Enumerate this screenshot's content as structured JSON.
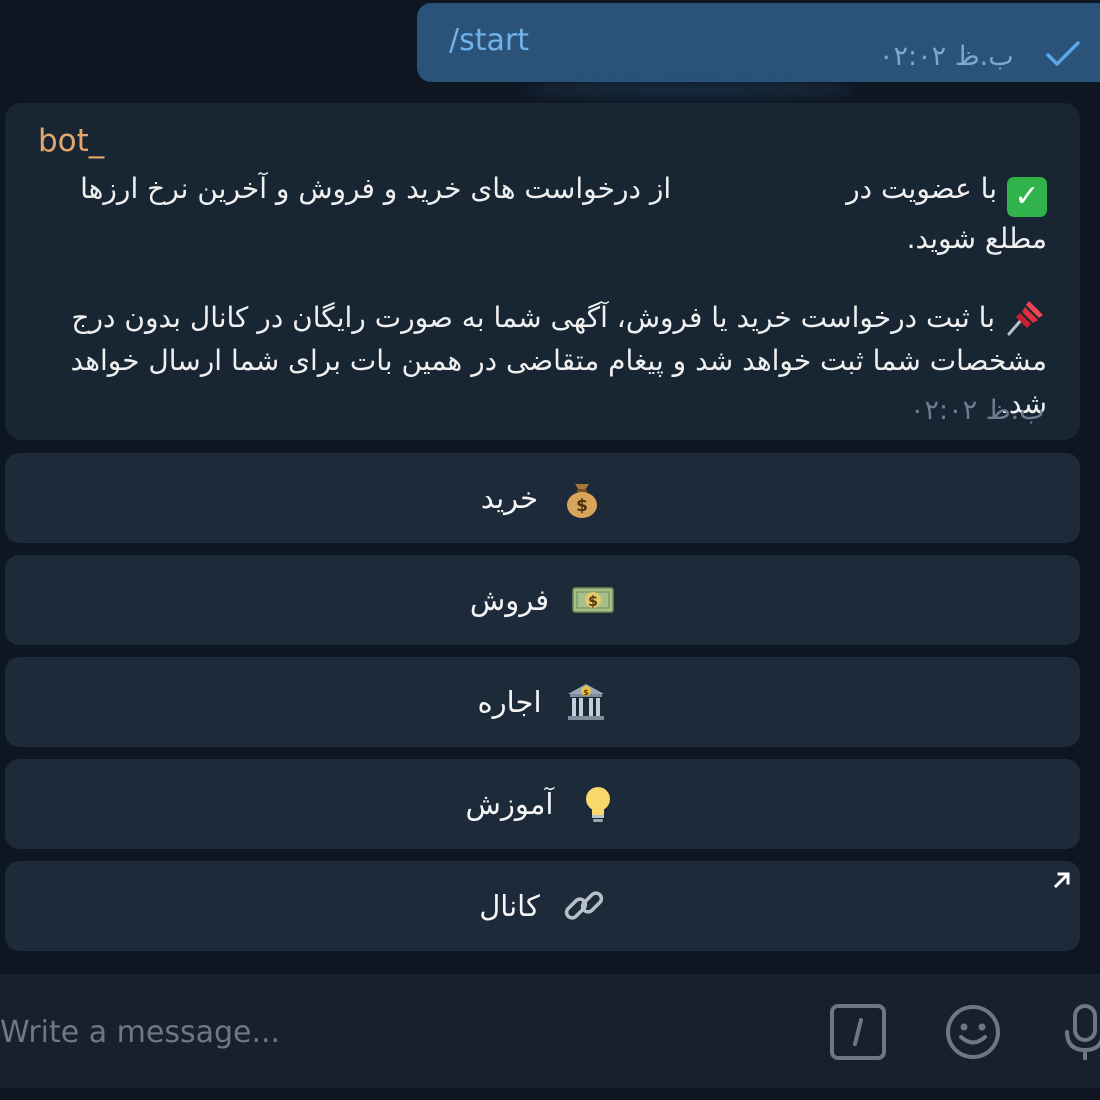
{
  "outgoing": {
    "text": "/start",
    "time": "ب.ظ ۰۲:۰۲",
    "status_icon": "double-check-icon"
  },
  "incoming": {
    "sender": "bot_",
    "line1": "با عضویت در",
    "line1b": "از درخواست های خرید و فروش و آخرین نرخ ارزها مطلع شوید.",
    "line2": "با ثبت درخواست خرید یا فروش، آگهی شما به صورت رایگان در کانال بدون درج مشخصات شما ثبت خواهد شد و پیغام متقاضی در همین بات برای شما ارسال خواهد شد.",
    "time": "ب.ظ ۰۲:۰۲",
    "icons": [
      "check-mark-emoji-icon",
      "pushpin-emoji-icon"
    ]
  },
  "keyboard": [
    {
      "label": "خرید",
      "icon": "money-bag-icon"
    },
    {
      "label": "فروش",
      "icon": "banknote-dollar-icon"
    },
    {
      "label": "اجاره",
      "icon": "bank-building-icon"
    },
    {
      "label": "آموزش",
      "icon": "light-bulb-icon"
    },
    {
      "label": "کانال",
      "icon": "link-chain-icon",
      "external_icon": "external-arrow-icon"
    }
  ],
  "composer": {
    "placeholder": "Write a message...",
    "icons": [
      "bot-command-icon",
      "emoji-smile-icon",
      "microphone-icon"
    ]
  },
  "colors": {
    "background": "#0e1621",
    "outgoing_bubble": "#2b5278",
    "incoming_bubble": "#182533",
    "keyboard_button": "#1c2a3a",
    "sender_name": "#e3a66d",
    "accent": "#6fb3ea"
  }
}
